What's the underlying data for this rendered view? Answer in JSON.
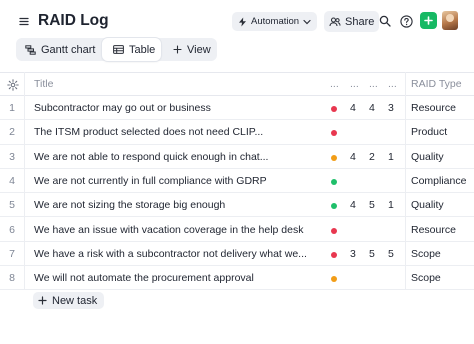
{
  "header": {
    "title": "RAID Log",
    "automation_label": "Automation",
    "share_label": "Share"
  },
  "tabs": [
    {
      "label": "Gantt chart",
      "icon": "gantt-icon"
    },
    {
      "label": "Table",
      "icon": "table-icon",
      "active": true
    },
    {
      "label": "View",
      "icon": "plus-icon"
    }
  ],
  "table": {
    "columns": [
      "Title",
      "...",
      "...",
      "...",
      "...",
      "RAID Type"
    ],
    "rows": [
      {
        "num": "1",
        "title": "Subcontractor may go out or business",
        "dot": "#e8374f",
        "a": "4",
        "b": "4",
        "c": "3",
        "type": "Resource"
      },
      {
        "num": "2",
        "title": "The ITSM product selected does not need CLIP...",
        "dot": "#e8374f",
        "a": "",
        "b": "",
        "c": "",
        "type": "Product"
      },
      {
        "num": "3",
        "title": "We are not able to respond quick enough in chat...",
        "dot": "#f29d17",
        "a": "4",
        "b": "2",
        "c": "1",
        "type": "Quality"
      },
      {
        "num": "4",
        "title": "We are not currently in full compliance with GDRP",
        "dot": "#1fbf6a",
        "a": "",
        "b": "",
        "c": "",
        "type": "Compliance"
      },
      {
        "num": "5",
        "title": "We are not sizing the storage big enough",
        "dot": "#1fbf6a",
        "a": "4",
        "b": "5",
        "c": "1",
        "type": "Quality"
      },
      {
        "num": "6",
        "title": "We have an issue with vacation coverage in the help desk",
        "dot": "#e8374f",
        "a": "",
        "b": "",
        "c": "",
        "type": "Resource"
      },
      {
        "num": "7",
        "title": "We have a risk with a subcontractor not delivery what we...",
        "dot": "#e8374f",
        "a": "3",
        "b": "5",
        "c": "5",
        "type": "Scope"
      },
      {
        "num": "8",
        "title": "We will not automate the procurement approval",
        "dot": "#f29d17",
        "a": "",
        "b": "",
        "c": "",
        "type": "Scope"
      }
    ]
  },
  "footer": {
    "new_task_label": "New task"
  }
}
